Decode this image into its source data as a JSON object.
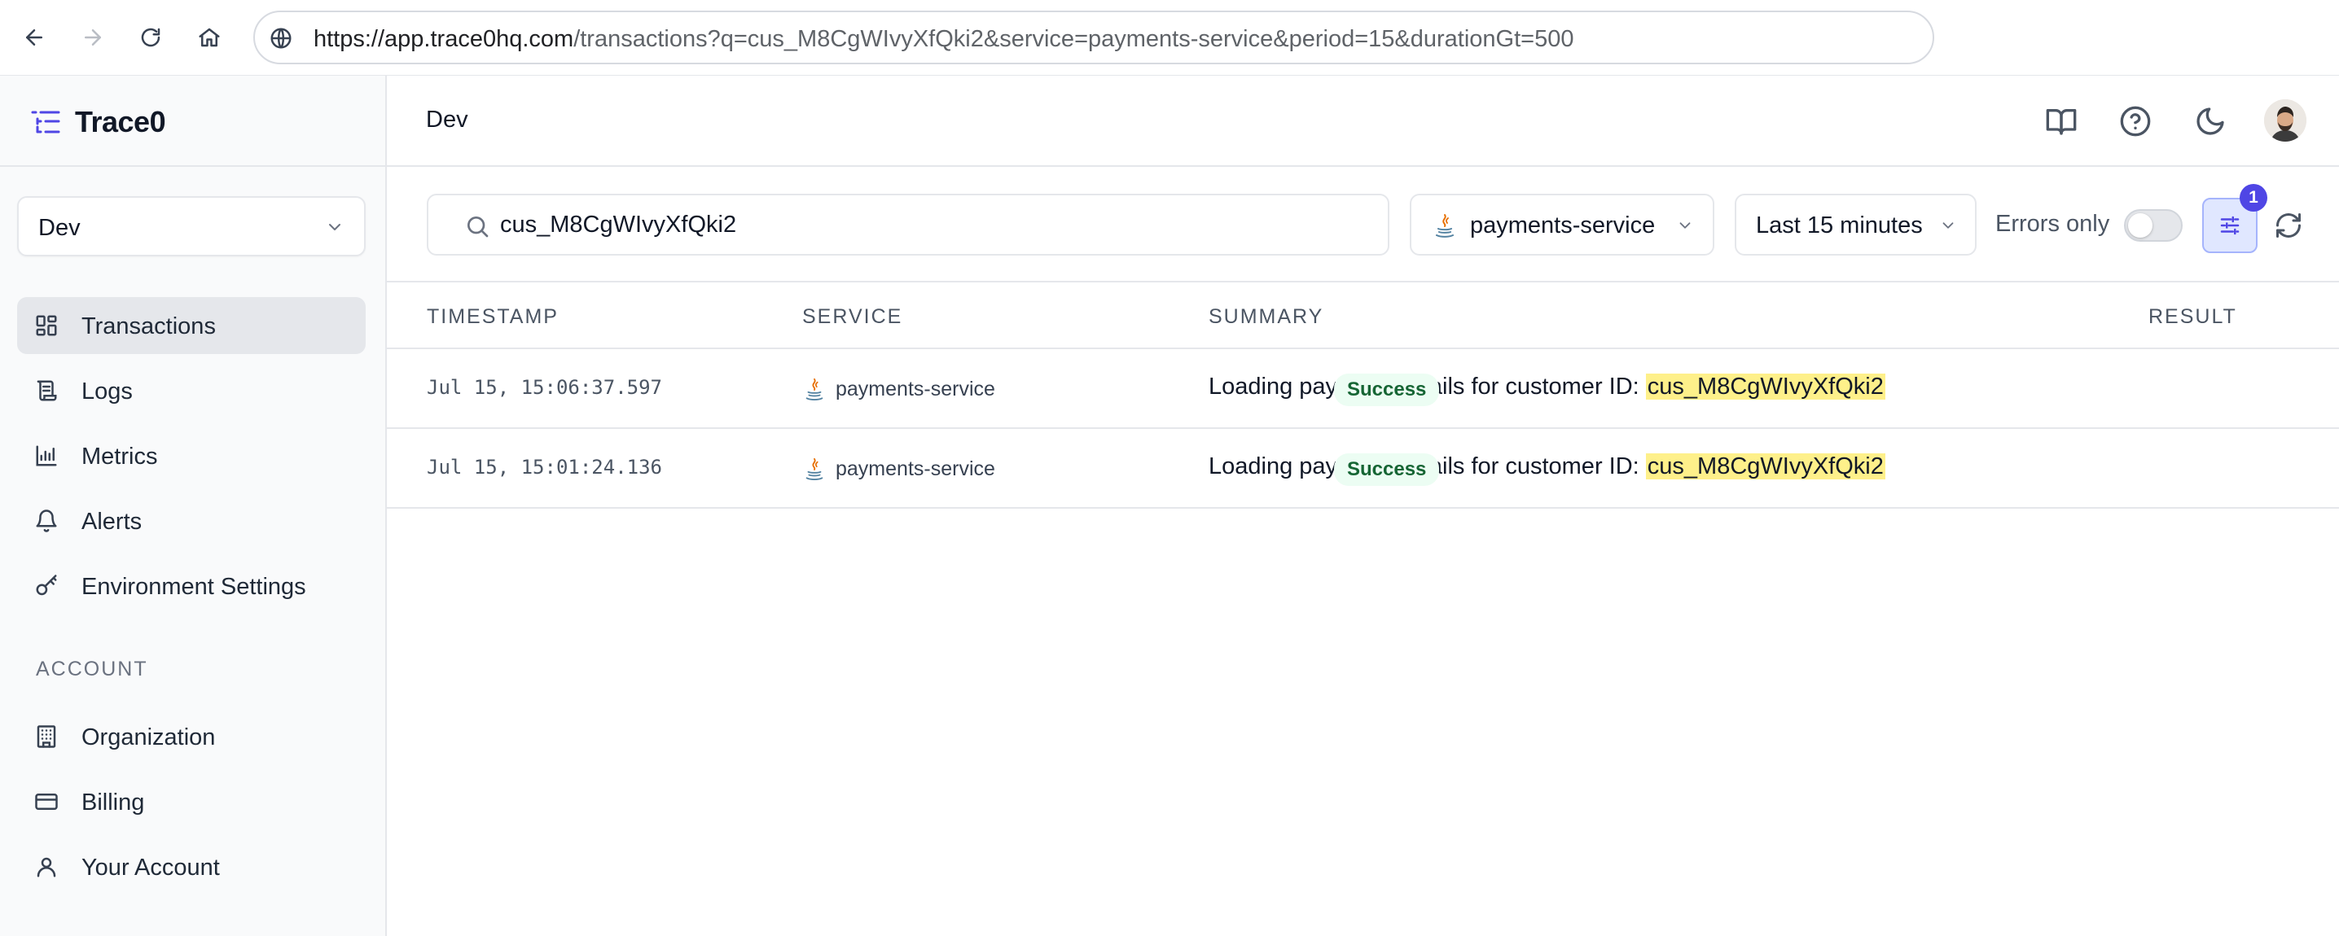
{
  "browser": {
    "url_host": "https://app.trace0hq.com",
    "url_rest": "/transactions?q=cus_M8CgWIvyXfQki2&service=payments-service&period=15&durationGt=500"
  },
  "app": {
    "name": "Trace0"
  },
  "sidebar": {
    "environment": "Dev",
    "items": [
      {
        "label": "Transactions",
        "icon": "dashboard-icon",
        "active": true
      },
      {
        "label": "Logs",
        "icon": "scroll-icon"
      },
      {
        "label": "Metrics",
        "icon": "bar-chart-icon"
      },
      {
        "label": "Alerts",
        "icon": "bell-icon"
      },
      {
        "label": "Environment Settings",
        "icon": "key-icon"
      }
    ],
    "account_section": "ACCOUNT",
    "account_items": [
      {
        "label": "Organization",
        "icon": "building-icon"
      },
      {
        "label": "Billing",
        "icon": "credit-card-icon"
      },
      {
        "label": "Your Account",
        "icon": "user-icon"
      }
    ]
  },
  "header": {
    "title": "Dev"
  },
  "filters": {
    "search_value": "cus_M8CgWIvyXfQki2",
    "service": "payments-service",
    "period": "Last 15 minutes",
    "errors_only_label": "Errors only",
    "errors_only": false,
    "active_filter_count": "1"
  },
  "table": {
    "columns": [
      "TIMESTAMP",
      "SERVICE",
      "SUMMARY",
      "RESULT"
    ],
    "rows": [
      {
        "timestamp": "Jul 15, 15:06:37.597",
        "service": "payments-service",
        "summary_prefix": "Loading payment details for customer ID: ",
        "summary_highlight": "cus_M8CgWIvyXfQki2",
        "result": "Success"
      },
      {
        "timestamp": "Jul 15, 15:01:24.136",
        "service": "payments-service",
        "summary_prefix": "Loading payment details for customer ID: ",
        "summary_highlight": "cus_M8CgWIvyXfQki2",
        "result": "Success"
      }
    ]
  },
  "colors": {
    "accent": "#4f46e5",
    "success_bg": "#ecfdf3",
    "success_text": "#166534",
    "highlight": "#fef08a"
  }
}
